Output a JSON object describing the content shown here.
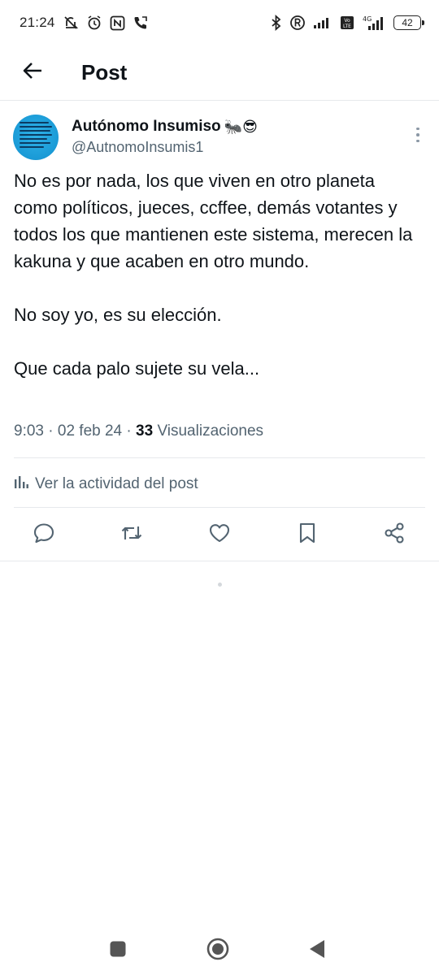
{
  "status_bar": {
    "time": "21:24",
    "battery": "42",
    "network": "4G",
    "volte": "Vo LTE"
  },
  "topbar": {
    "title": "Post"
  },
  "post": {
    "author_name": "Autónomo Insumiso",
    "author_emoji": "🐜😎",
    "author_handle": "@AutnomoInsumis1",
    "text": "No es por nada, los que viven en otro planeta como políticos, jueces, ccffee, demás votantes y todos los que mantienen este sistema, merecen la kakuna y que acaben en otro mundo.\n\nNo soy yo, es su elección.\n\nQue cada palo sujete su vela...",
    "time": "9:03",
    "date": "02 feb 24",
    "views_count": "33",
    "views_label": "Visualizaciones",
    "activity_label": "Ver la actividad del post"
  },
  "icons": {
    "back": "arrow-left-icon",
    "reply": "reply-icon",
    "retweet": "retweet-icon",
    "like": "heart-icon",
    "bookmark": "bookmark-icon",
    "share": "share-icon",
    "more": "more-vertical-icon"
  },
  "colors": {
    "text": "#0f1419",
    "secondary": "#536471",
    "divider": "#e6e9ec"
  }
}
